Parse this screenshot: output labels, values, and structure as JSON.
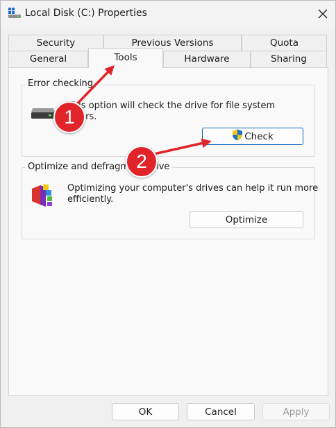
{
  "window": {
    "title": "Local Disk (C:) Properties"
  },
  "tabs_row1": [
    "Security",
    "Previous Versions",
    "Quota"
  ],
  "tabs_row2": [
    "General",
    "Tools",
    "Hardware",
    "Sharing"
  ],
  "active_tab": "Tools",
  "error_checking": {
    "label": "Error checking",
    "line1": "This option will check the drive for file system",
    "line2": "errors.",
    "button": "Check"
  },
  "optimize": {
    "label": "Optimize and defragment drive",
    "line1": "Optimizing your computer's drives can help it run more",
    "line2": "efficiently.",
    "button": "Optimize"
  },
  "footer": {
    "ok": "OK",
    "cancel": "Cancel",
    "apply": "Apply"
  },
  "annotations": {
    "marker1": "1",
    "marker2": "2"
  },
  "colors": {
    "accent": "#0a64b4",
    "annotation": "#e0242a"
  }
}
